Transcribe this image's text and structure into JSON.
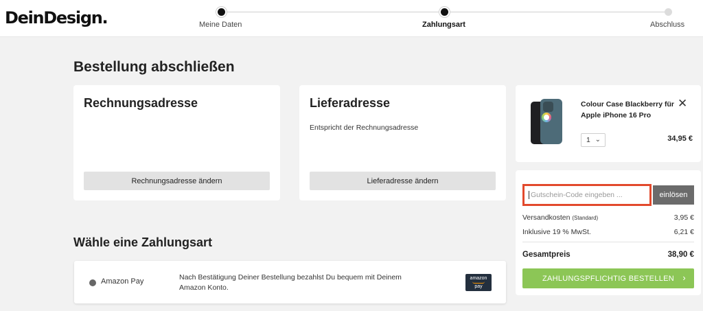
{
  "header": {
    "logo": "DeinDesign.",
    "steps": [
      {
        "label": "Meine Daten",
        "state": "done"
      },
      {
        "label": "Zahlungsart",
        "state": "active"
      },
      {
        "label": "Abschluss",
        "state": "todo"
      }
    ]
  },
  "main": {
    "title": "Bestellung abschließen",
    "billing": {
      "title": "Rechnungsadresse",
      "button": "Rechnungsadresse ändern"
    },
    "shipping": {
      "title": "Lieferadresse",
      "text": "Entspricht der Rechnungsadresse",
      "button": "Lieferadresse ändern"
    },
    "payment": {
      "title": "Wähle eine Zahlungsart",
      "option": {
        "name": "Amazon Pay",
        "description": "Nach Bestätigung Deiner Bestellung bezahlst Du bequem mit Deinem Amazon Konto.",
        "logo_top": "amazon",
        "logo_bottom": "pay"
      }
    }
  },
  "cart": {
    "product": {
      "name": "Colour Case Blackberry für Apple iPhone 16 Pro",
      "quantity": "1",
      "price": "34,95 €",
      "remove_icon": "close-icon"
    },
    "coupon": {
      "placeholder": "Gutschein-Code eingeben ...",
      "button": "einlösen"
    },
    "shipping": {
      "label": "Versandkosten",
      "sub": "(Standard)",
      "value": "3,95 €"
    },
    "vat": {
      "label": "Inklusive 19 % MwSt.",
      "value": "6,21 €"
    },
    "total": {
      "label": "Gesamtpreis",
      "value": "38,90 €"
    },
    "order_button": "ZAHLUNGSPFLICHTIG BESTELLEN"
  },
  "colors": {
    "accent_green": "#8cc656",
    "highlight_red": "#e2492c",
    "coupon_button": "#6b6b6b",
    "amazon_dark": "#232f3e"
  }
}
